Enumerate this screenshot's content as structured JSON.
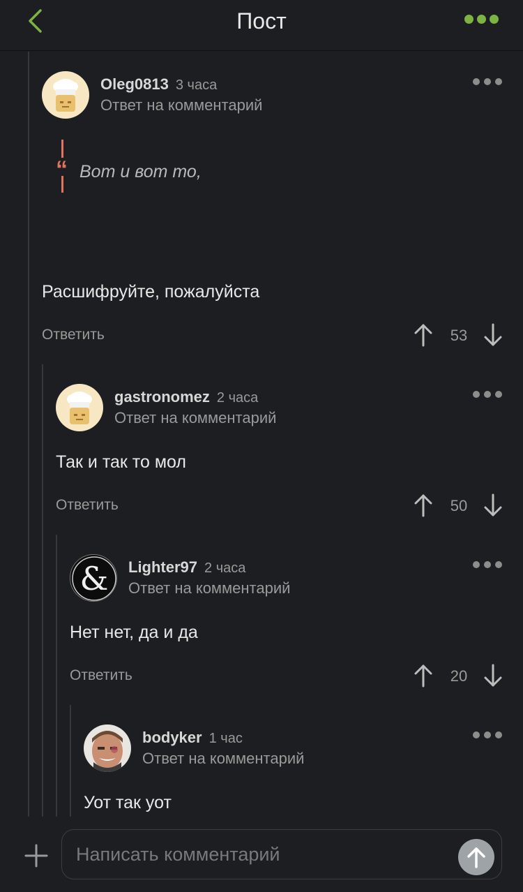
{
  "header": {
    "title": "Пост",
    "accent_color": "#7cb342",
    "back_icon": "chevron-left-icon",
    "more_icon": "more-dots-icon"
  },
  "comments": [
    {
      "username": "Oleg0813",
      "time": "3 часа",
      "reply_to": "Ответ на комментарий",
      "quote": "Вот и вот то,",
      "text": "Расшифруйте, пожалуйста",
      "reply_label": "Ответить",
      "rating": "53",
      "avatar": "chef-hat-avatar"
    },
    {
      "username": "gastronomez",
      "time": "2 часа",
      "reply_to": "Ответ на комментарий",
      "text": "Так и так то мол",
      "reply_label": "Ответить",
      "rating": "50",
      "avatar": "chef-hat-avatar"
    },
    {
      "username": "Lighter97",
      "time": "2 часа",
      "reply_to": "Ответ на комментарий",
      "text": "Нет нет, да и да",
      "reply_label": "Ответить",
      "rating": "20",
      "avatar": "ampersand-avatar"
    },
    {
      "username": "bodyker",
      "time": "1 час",
      "reply_to": "Ответ на комментарий",
      "text": "Уот так уот",
      "avatar": "photo-avatar"
    }
  ],
  "composer": {
    "placeholder": "Написать комментарий",
    "add_icon": "plus-icon",
    "send_icon": "send-arrow-icon"
  }
}
